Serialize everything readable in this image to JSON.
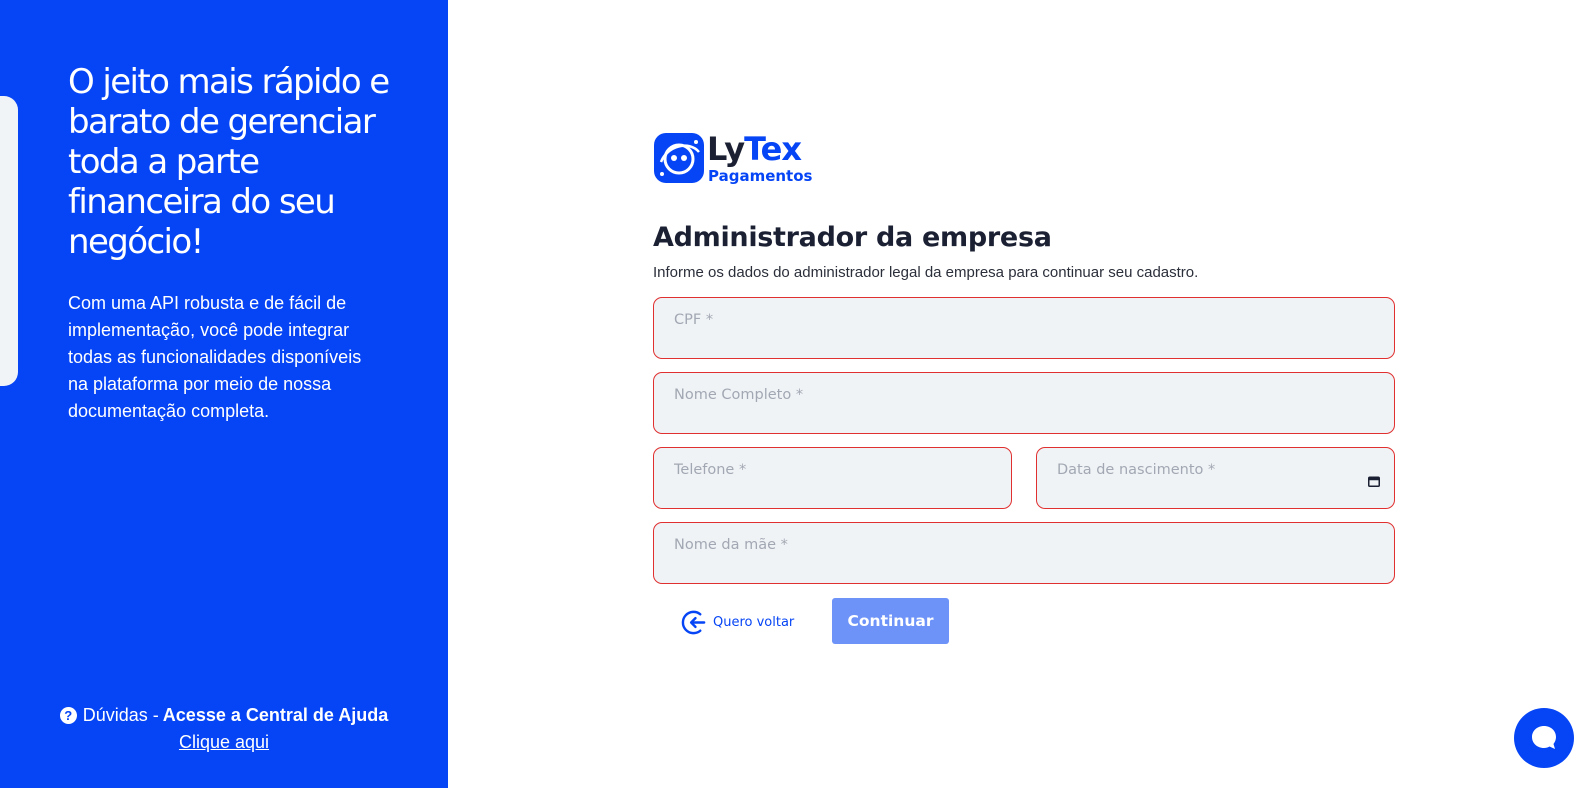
{
  "hero": {
    "title": "O jeito mais rápido e barato de gerenciar toda a parte financeira do seu negócio!",
    "text": "Com uma API robusta e de fácil de implementação, você pode integrar todas as funcionalidades disponíveis na plataforma por meio de nossa documentação completa."
  },
  "help": {
    "icon": "?",
    "prefix": "Dúvidas - ",
    "cta": "Acesse a Central de Ajuda",
    "link": "Clique aqui"
  },
  "logo": {
    "ly": "Ly",
    "tex": "Tex",
    "sub": "Pagamentos"
  },
  "form": {
    "title": "Administrador da empresa",
    "subtitle": "Informe os dados do administrador legal da empresa para continuar seu cadastro.",
    "fields": {
      "cpf": {
        "placeholder": "CPF *",
        "value": ""
      },
      "full_name": {
        "placeholder": "Nome Completo *",
        "value": ""
      },
      "phone": {
        "placeholder": "Telefone *",
        "value": ""
      },
      "birth_date": {
        "placeholder": "Data de nascimento *",
        "value": ""
      },
      "mother_name": {
        "placeholder": "Nome da mãe *",
        "value": ""
      }
    },
    "back_label": "Quero voltar",
    "continue_label": "Continuar"
  },
  "colors": {
    "brand_blue": "#0645f5",
    "error_border": "#e0302f",
    "input_bg": "#f0f3f6",
    "button_disabled": "#6d93f8"
  },
  "icons": {
    "help": "question-circle-icon",
    "back": "arrow-left-circle-icon",
    "calendar": "calendar-icon",
    "chat": "chat-bubble-icon"
  }
}
